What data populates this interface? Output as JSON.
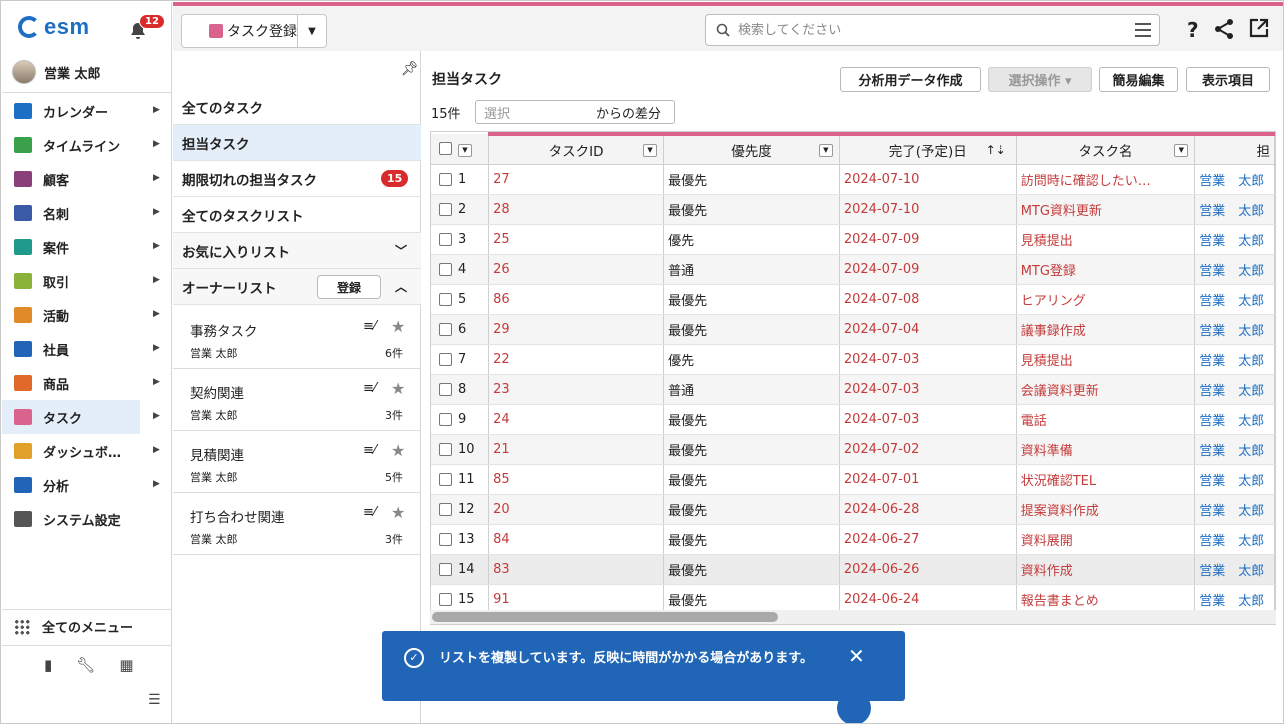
{
  "app": {
    "logo_text": "esm",
    "notifications_count": "12",
    "user_name": "営業 太郎"
  },
  "sidebar": {
    "items": [
      {
        "label": "カレンダー",
        "icon": "calendar-icon",
        "color": "#1d6fc3"
      },
      {
        "label": "タイムライン",
        "icon": "timeline-icon",
        "color": "#3aa14a"
      },
      {
        "label": "顧客",
        "icon": "building-icon",
        "color": "#8a3f7a"
      },
      {
        "label": "名刺",
        "icon": "business-card-icon",
        "color": "#3a5aa8"
      },
      {
        "label": "案件",
        "icon": "folder-icon",
        "color": "#1f9a8a"
      },
      {
        "label": "取引",
        "icon": "transaction-icon",
        "color": "#8ab33a"
      },
      {
        "label": "活動",
        "icon": "clipboard-icon",
        "color": "#e08a2a"
      },
      {
        "label": "社員",
        "icon": "person-icon",
        "color": "#2166b6"
      },
      {
        "label": "商品",
        "icon": "box-icon",
        "color": "#e0692a"
      },
      {
        "label": "タスク",
        "icon": "task-check-icon",
        "color": "#d9638d"
      },
      {
        "label": "ダッシュボ…",
        "icon": "dashboard-icon",
        "color": "#e0a02a"
      },
      {
        "label": "分析",
        "icon": "chart-icon",
        "color": "#2166b6"
      },
      {
        "label": "システム設定",
        "icon": "gear-icon",
        "color": "#555555"
      }
    ],
    "all_menu_label": "全てのメニュー"
  },
  "topbar": {
    "register_label": "タスク登録",
    "search_placeholder": "検索してください",
    "help_glyph": "?",
    "share_glyph": "<",
    "external_glyph": "⧉"
  },
  "lists": {
    "all_tasks": "全てのタスク",
    "my_tasks": "担当タスク",
    "overdue": "期限切れの担当タスク",
    "overdue_count": "15",
    "all_task_lists": "全てのタスクリスト",
    "favorites": "お気に入りリスト",
    "owner_lists": "オーナーリスト",
    "owner_register": "登録",
    "owner_items": [
      {
        "name": "事務タスク",
        "user": "営業 太郎",
        "count": "6件"
      },
      {
        "name": "契約関連",
        "user": "営業 太郎",
        "count": "3件"
      },
      {
        "name": "見積関連",
        "user": "営業 太郎",
        "count": "5件"
      },
      {
        "name": "打ち合わせ関連",
        "user": "営業 太郎",
        "count": "3件"
      }
    ]
  },
  "main": {
    "title": "担当タスク",
    "buttons": {
      "analysis": "分析用データ作成",
      "bulk": "選択操作 ▾",
      "quick_edit": "簡易編集",
      "columns": "表示項目"
    },
    "count": "15件",
    "diff_placeholder": "選択",
    "diff_suffix": "からの差分",
    "columns": [
      "タスクID",
      "優先度",
      "完了(予定)日",
      "タスク名",
      "担"
    ],
    "rows": [
      {
        "n": "1",
        "id": "27",
        "priority": "最優先",
        "date": "2024-07-10",
        "name": "訪問時に確認したい…",
        "owner": "営業　太郎"
      },
      {
        "n": "2",
        "id": "28",
        "priority": "最優先",
        "date": "2024-07-10",
        "name": "MTG資料更新",
        "owner": "営業　太郎"
      },
      {
        "n": "3",
        "id": "25",
        "priority": "優先",
        "date": "2024-07-09",
        "name": "見積提出",
        "owner": "営業　太郎"
      },
      {
        "n": "4",
        "id": "26",
        "priority": "普通",
        "date": "2024-07-09",
        "name": "MTG登録",
        "owner": "営業　太郎"
      },
      {
        "n": "5",
        "id": "86",
        "priority": "最優先",
        "date": "2024-07-08",
        "name": "ヒアリング",
        "owner": "営業　太郎"
      },
      {
        "n": "6",
        "id": "29",
        "priority": "最優先",
        "date": "2024-07-04",
        "name": "議事録作成",
        "owner": "営業　太郎"
      },
      {
        "n": "7",
        "id": "22",
        "priority": "優先",
        "date": "2024-07-03",
        "name": "見積提出",
        "owner": "営業　太郎"
      },
      {
        "n": "8",
        "id": "23",
        "priority": "普通",
        "date": "2024-07-03",
        "name": "会議資料更新",
        "owner": "営業　太郎"
      },
      {
        "n": "9",
        "id": "24",
        "priority": "最優先",
        "date": "2024-07-03",
        "name": "電話",
        "owner": "営業　太郎"
      },
      {
        "n": "10",
        "id": "21",
        "priority": "最優先",
        "date": "2024-07-02",
        "name": "資料準備",
        "owner": "営業　太郎"
      },
      {
        "n": "11",
        "id": "85",
        "priority": "最優先",
        "date": "2024-07-01",
        "name": "状況確認TEL",
        "owner": "営業　太郎"
      },
      {
        "n": "12",
        "id": "20",
        "priority": "最優先",
        "date": "2024-06-28",
        "name": "提案資料作成",
        "owner": "営業　太郎"
      },
      {
        "n": "13",
        "id": "84",
        "priority": "最優先",
        "date": "2024-06-27",
        "name": "資料展開",
        "owner": "営業　太郎"
      },
      {
        "n": "14",
        "id": "83",
        "priority": "最優先",
        "date": "2024-06-26",
        "name": "資料作成",
        "owner": "営業　太郎"
      },
      {
        "n": "15",
        "id": "91",
        "priority": "最優先",
        "date": "2024-06-24",
        "name": "報告書まとめ",
        "owner": "営業　太郎"
      }
    ]
  },
  "toast": {
    "message": "リストを複製しています。反映に時間がかかる場合があります。",
    "close": "✕"
  },
  "colors": {
    "accent": "#d9638d",
    "link_red": "#c43b3b",
    "link_blue": "#1d6fc3",
    "toast_bg": "#2166b6"
  }
}
